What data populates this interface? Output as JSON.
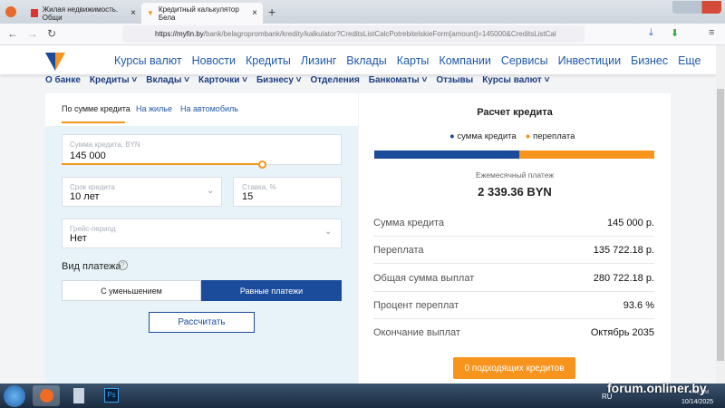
{
  "browser": {
    "tabs": [
      {
        "title": "Жилая недвижимость. Общи"
      },
      {
        "title": "Кредитный калькулятор Бела"
      }
    ],
    "url_domain": "https://myfin.by",
    "url_path": "/bank/belagroprombank/kredity/kalkulator?CreditsListCalcPotrebitelskieForm[amount]=145000&CreditsListCal"
  },
  "nav": {
    "main": [
      "Курсы валют",
      "Новости",
      "Кредиты",
      "Лизинг",
      "Вклады",
      "Карты",
      "Компании",
      "Сервисы",
      "Инвестиции",
      "Бизнес",
      "Еще"
    ],
    "sub": [
      "О банке",
      "Кредиты ˅",
      "Вклады ˅",
      "Карточки ˅",
      "Бизнесу ˅",
      "Отделения",
      "Банкоматы ˅",
      "Отзывы",
      "Курсы валют ˅"
    ]
  },
  "calc": {
    "tabs": [
      "По сумме кредита",
      "На жилье",
      "На автомобиль"
    ],
    "amount": {
      "label": "Сумма кредита, BYN",
      "value": "145 000",
      "slider_fraction": 0.715
    },
    "term": {
      "label": "Срок кредита",
      "value": "10 лет"
    },
    "rate": {
      "label": "Ставка, %",
      "value": "15"
    },
    "grace": {
      "label": "Грейс-период",
      "value": "Нет"
    },
    "payment_type_label": "Вид платежа",
    "payment_options": [
      "С уменьшением",
      "Равные платежи"
    ],
    "selected_option": 1,
    "calculate": "Рассчитать"
  },
  "result": {
    "title": "Расчет кредита",
    "legend": [
      "сумма кредита",
      "переплата"
    ],
    "principal_share": 0.517,
    "monthly_label": "Ежемесячный платеж",
    "monthly_value": "2 339.36 BYN",
    "rows": [
      {
        "k": "Сумма кредита",
        "v": "145 000 р."
      },
      {
        "k": "Переплата",
        "v": "135 722.18 р."
      },
      {
        "k": "Общая сумма выплат",
        "v": "280 722.18 р."
      },
      {
        "k": "Процент переплат",
        "v": "93.6 %"
      },
      {
        "k": "Окончание выплат",
        "v": "Октябрь 2035"
      }
    ],
    "offers_button": "0 подходящих кредитов"
  },
  "colors": {
    "blue": "#1b4b9b",
    "orange": "#f7941d"
  },
  "taskbar": {
    "lang": "RU",
    "time": "4:45 PM",
    "date": "10/14/2025",
    "watermark": "forum.onliner.by"
  }
}
